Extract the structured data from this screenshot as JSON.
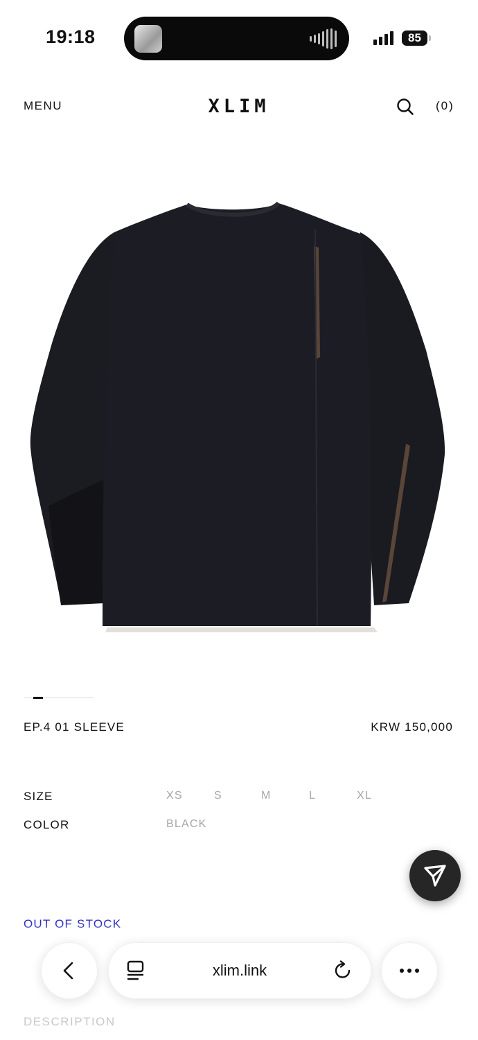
{
  "status_bar": {
    "time": "19:18",
    "battery": "85"
  },
  "header": {
    "menu_label": "MENU",
    "logo": "XLIM",
    "search_icon": "search-icon",
    "cart_label": "(0)"
  },
  "product": {
    "image_icon": "black-long-sleeve-shirt-image",
    "name": "EP.4 01 SLEEVE",
    "price": "KRW 150,000",
    "options": {
      "size_label": "SIZE",
      "sizes": [
        "XS",
        "S",
        "M",
        "L",
        "XL"
      ],
      "color_label": "COLOR",
      "colors": [
        "BLACK"
      ]
    },
    "stock_status": "OUT OF STOCK",
    "description_label": "DESCRIPTION"
  },
  "floating_button": {
    "icon": "send-icon"
  },
  "browser_bar": {
    "back_icon": "chevron-left-icon",
    "reader_icon": "reader-icon",
    "url": "xlim.link",
    "reload_icon": "reload-icon",
    "more_icon": "more-icon"
  },
  "colors": {
    "accent_out_of_stock": "#2727c4",
    "muted_option": "#a5a5a5",
    "text": "#111111"
  }
}
